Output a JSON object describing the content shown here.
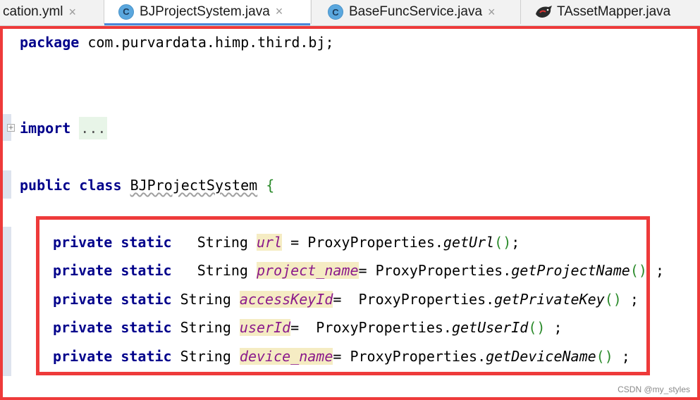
{
  "tabs": [
    {
      "label": "cation.yml",
      "icon": "none",
      "active": false
    },
    {
      "label": "BJProjectSystem.java",
      "icon": "class-c-icon",
      "active": true
    },
    {
      "label": "BaseFuncService.java",
      "icon": "class-c-icon",
      "active": false
    },
    {
      "label": "TAssetMapper.java",
      "icon": "mybatis-bird-icon",
      "active": false
    }
  ],
  "close_glyph": "×",
  "class_icon_letter": "C",
  "code": {
    "package_kw": "package",
    "package_name": " com.purvardata.himp.third.bj;",
    "import_kw": "import",
    "import_folded": "...",
    "class_kw1": "public",
    "class_kw2": "class",
    "class_name": "BJProjectSystem",
    "open_brace": "{",
    "fields": [
      {
        "mods": "private static",
        "gap": "  ",
        "type": "String",
        "name": "url",
        "eq": " = ",
        "call": "ProxyProperties.",
        "method": "getUrl",
        "parens": "()",
        "tail": ";"
      },
      {
        "mods": "private static",
        "gap": "  ",
        "type": "String",
        "name": "project_name",
        "eq": "= ",
        "call": "ProxyProperties.",
        "method": "getProjectName",
        "parens": "()",
        "tail": " ;"
      },
      {
        "mods": "private static",
        "gap": " ",
        "type": "String",
        "name": "accessKeyId",
        "eq": "=  ",
        "call": "ProxyProperties.",
        "method": "getPrivateKey",
        "parens": "()",
        "tail": " ;"
      },
      {
        "mods": "private static",
        "gap": " ",
        "type": "String",
        "name": "userId",
        "eq": "=  ",
        "call": "ProxyProperties.",
        "method": "getUserId",
        "parens": "()",
        "tail": " ;"
      },
      {
        "mods": "private static",
        "gap": " ",
        "type": "String",
        "name": "device_name",
        "eq": "= ",
        "call": "ProxyProperties.",
        "method": "getDeviceName",
        "parens": "()",
        "tail": " ;"
      }
    ]
  },
  "watermark": "CSDN @my_styles",
  "colors": {
    "highlight_frame": "#ee3a3a",
    "keyword": "#00008b",
    "field": "#8b1a8b",
    "active_tab": "#4a87d9"
  }
}
